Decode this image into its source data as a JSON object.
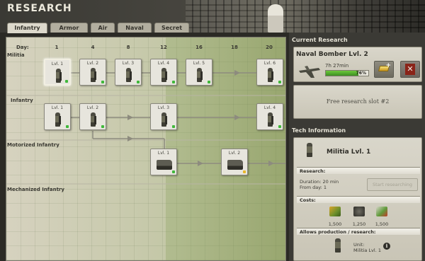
{
  "header": {
    "title": "RESEARCH",
    "tabs": [
      {
        "label": "Infantry",
        "active": true
      },
      {
        "label": "Armor",
        "active": false
      },
      {
        "label": "Air",
        "active": false
      },
      {
        "label": "Naval",
        "active": false
      },
      {
        "label": "Secret",
        "active": false
      }
    ]
  },
  "tree": {
    "day_label": "Day:",
    "days": [
      "1",
      "4",
      "8",
      "12",
      "16",
      "18",
      "20"
    ],
    "categories": [
      "Militia",
      "Infantry",
      "Motorized Infantry",
      "Mechanized Infantry"
    ],
    "cards": [
      {
        "row": "militia",
        "label": "Lvl. 1",
        "icon": "soldier-icon",
        "status": "researched",
        "selected": true
      },
      {
        "row": "militia",
        "label": "Lvl. 2",
        "icon": "soldier-icon",
        "status": "researched"
      },
      {
        "row": "militia",
        "label": "Lvl. 3",
        "icon": "soldier-icon",
        "status": "researched"
      },
      {
        "row": "militia",
        "label": "Lvl. 4",
        "icon": "soldier-icon",
        "status": "researched"
      },
      {
        "row": "militia",
        "label": "Lvl. 5",
        "icon": "soldier-icon",
        "status": "researched"
      },
      {
        "row": "militia",
        "label": "Lvl. 6",
        "icon": "soldier-icon",
        "status": "researched"
      },
      {
        "row": "infantry",
        "label": "Lvl. 1",
        "icon": "soldier-icon",
        "status": "researched"
      },
      {
        "row": "infantry",
        "label": "Lvl. 2",
        "icon": "soldier-icon",
        "status": "researched"
      },
      {
        "row": "infantry",
        "label": "Lvl. 3",
        "icon": "soldier-icon",
        "status": "researched"
      },
      {
        "row": "infantry",
        "label": "Lvl. 4",
        "icon": "soldier-icon",
        "status": "researched"
      },
      {
        "row": "motorized",
        "label": "Lvl. 1",
        "icon": "truck-icon",
        "status": "researched"
      },
      {
        "row": "motorized",
        "label": "Lvl. 2",
        "icon": "truck-icon",
        "status": "available"
      }
    ]
  },
  "current_research": {
    "heading": "Current Research",
    "title": "Naval Bomber Lvl. 2",
    "icon": "plane-icon",
    "time_left": "7h 27min",
    "progress": 76,
    "progress_text": "76%",
    "free_slot": "Free research slot #2"
  },
  "tech_info": {
    "heading": "Tech Information",
    "name": "Militia Lvl. 1",
    "icon": "soldier-icon",
    "research_heading": "Research:",
    "duration": "Duration: 20 min",
    "from_day": "From day: 1",
    "start_button": "Start researching",
    "costs_heading": "Costs:",
    "costs": [
      {
        "icon": "supplies-icon",
        "value": "1,500"
      },
      {
        "icon": "metal-icon",
        "value": "1,250"
      },
      {
        "icon": "components-icon",
        "value": "1,500"
      }
    ],
    "allows_heading": "Allows production / research:",
    "unit_label": "Unit:",
    "unit_name": "Militia Lvl. 1"
  },
  "colors": {
    "researched": "#3fb83a",
    "available": "#e8b72a",
    "progress": "#4fa82c",
    "cancel": "#8a2318"
  }
}
